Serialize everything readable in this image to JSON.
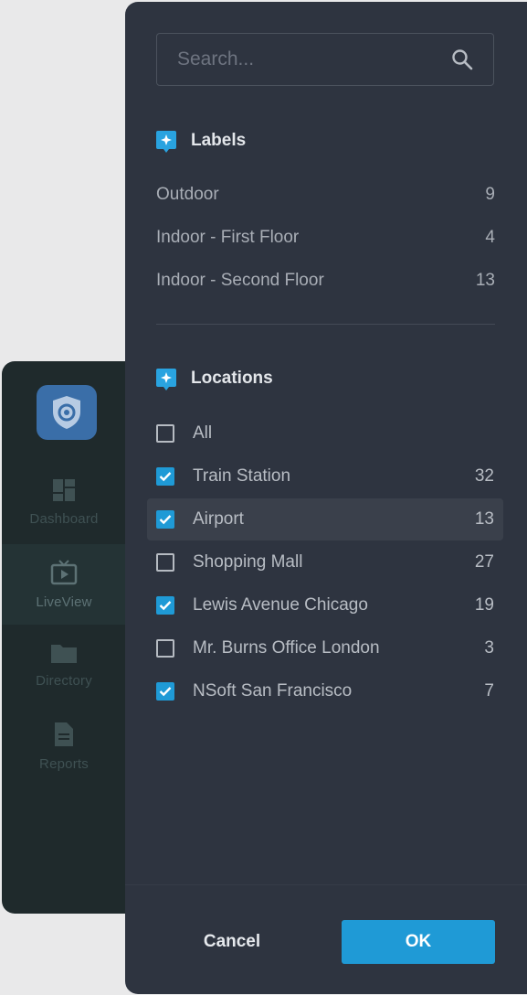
{
  "sidebar": {
    "logo_icon": "shield-icon",
    "items": [
      {
        "label": "Dashboard",
        "icon": "dashboard-icon"
      },
      {
        "label": "LiveView",
        "icon": "tv-play-icon"
      },
      {
        "label": "Directory",
        "icon": "folder-icon"
      },
      {
        "label": "Reports",
        "icon": "document-icon"
      }
    ]
  },
  "search": {
    "placeholder": "Search...",
    "value": "",
    "icon": "search-icon"
  },
  "labels": {
    "title": "Labels",
    "icon": "tag-icon",
    "items": [
      {
        "label": "Outdoor",
        "count": "9"
      },
      {
        "label": "Indoor - First Floor",
        "count": "4"
      },
      {
        "label": "Indoor - Second Floor",
        "count": "13"
      }
    ]
  },
  "locations": {
    "title": "Locations",
    "icon": "tag-icon",
    "all_label": "All",
    "all_checked": false,
    "items": [
      {
        "label": "Train Station",
        "count": "32",
        "checked": true
      },
      {
        "label": "Airport",
        "count": "13",
        "checked": true,
        "highlighted": true
      },
      {
        "label": "Shopping Mall",
        "count": "27",
        "checked": false
      },
      {
        "label": "Lewis Avenue Chicago",
        "count": "19",
        "checked": true
      },
      {
        "label": "Mr. Burns Office London",
        "count": "3",
        "checked": false
      },
      {
        "label": "NSoft San Francisco",
        "count": "7",
        "checked": true
      }
    ]
  },
  "footer": {
    "cancel_label": "Cancel",
    "ok_label": "OK"
  },
  "colors": {
    "panel_bg": "#2e3440",
    "accent": "#1f9ad6",
    "sidebar_bg": "#1f2a2c"
  }
}
